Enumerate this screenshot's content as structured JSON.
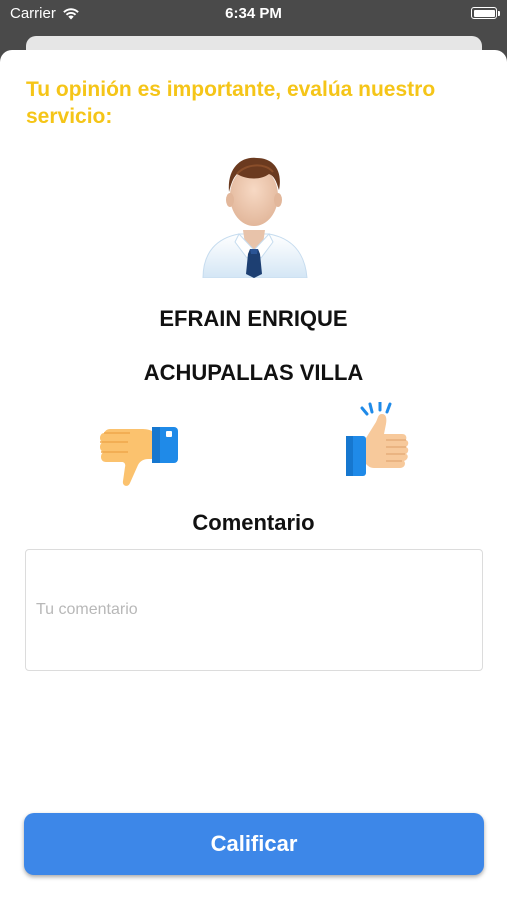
{
  "status_bar": {
    "carrier": "Carrier",
    "time": "6:34 PM",
    "wifi_icon": "wifi-icon",
    "battery_icon": "battery-full-icon"
  },
  "rating": {
    "prompt": "Tu opinión es importante, evalúa nuestro servicio:",
    "prompt_color": "#f5c518",
    "avatar_icon": "user-avatar-icon",
    "name_first": "EFRAIN ENRIQUE",
    "name_last": "ACHUPALLAS VILLA",
    "thumbs_down_icon": "thumbs-down-icon",
    "thumbs_up_icon": "thumbs-up-icon"
  },
  "comment": {
    "title": "Comentario",
    "value": "",
    "placeholder": "Tu comentario"
  },
  "submit": {
    "label": "Calificar",
    "color": "#3d87e8"
  }
}
